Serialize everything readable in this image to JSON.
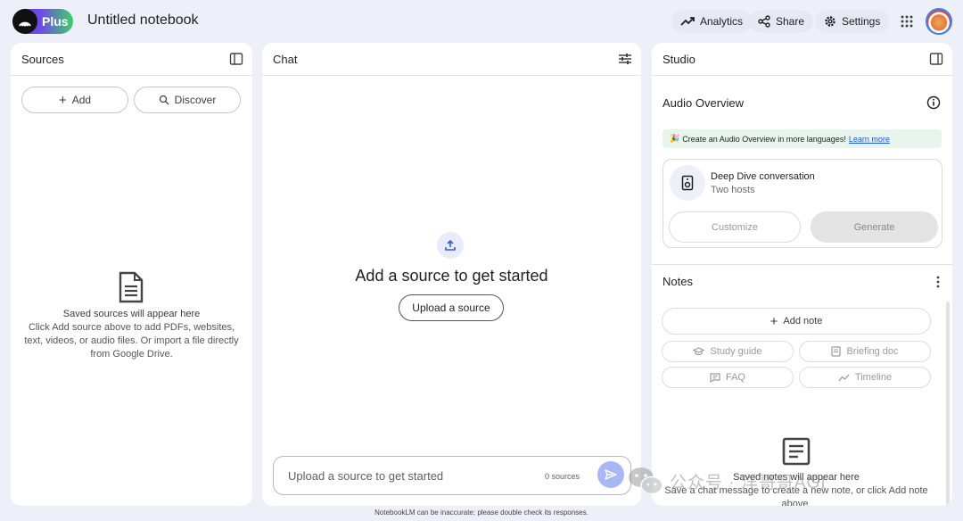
{
  "header": {
    "plan_badge": "Plus",
    "notebook_title": "Untitled notebook",
    "analytics_label": "Analytics",
    "share_label": "Share",
    "settings_label": "Settings"
  },
  "sources": {
    "title": "Sources",
    "add_label": "Add",
    "discover_label": "Discover",
    "empty_title": "Saved sources will appear here",
    "empty_line1": "Click Add source above to add PDFs, websites,",
    "empty_line2": "text, videos, or audio files. Or import a file directly",
    "empty_line3": "from Google Drive."
  },
  "chat": {
    "title": "Chat",
    "heading": "Add a source to get started",
    "upload_label": "Upload a source",
    "input_placeholder": "Upload a source to get started",
    "source_count": "0 sources"
  },
  "studio": {
    "title": "Studio",
    "audio_overview_title": "Audio Overview",
    "banner_emoji": "🎉",
    "banner_text": "Create an Audio Overview in more languages!",
    "banner_link": "Learn more",
    "deep_dive_title": "Deep Dive conversation",
    "deep_dive_sub": "Two hosts",
    "customize_label": "Customize",
    "generate_label": "Generate",
    "notes_title": "Notes",
    "add_note_label": "Add note",
    "study_guide_label": "Study guide",
    "briefing_doc_label": "Briefing doc",
    "faq_label": "FAQ",
    "timeline_label": "Timeline",
    "notes_empty_title": "Saved notes will appear here",
    "notes_empty_line1": "Save a chat message to create a new note, or click Add note",
    "notes_empty_line2": "above."
  },
  "footer": {
    "disclaimer": "NotebookLM can be inaccurate; please double check its responses."
  },
  "watermark": {
    "text": "公众号 · 洋哥哥AGI"
  },
  "colors": {
    "background": "#eef0f9",
    "panel": "#ffffff",
    "accent": "#a9b8f5",
    "banner": "#e8f5ec",
    "link": "#1a56db"
  }
}
